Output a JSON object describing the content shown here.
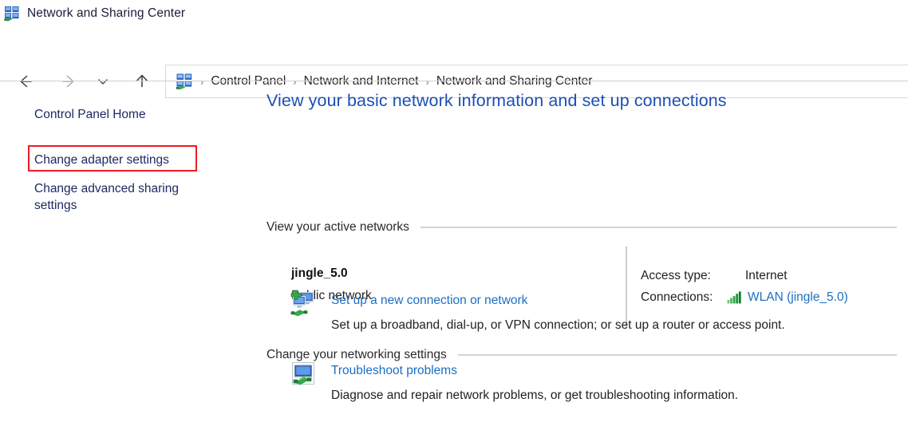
{
  "window": {
    "title": "Network and Sharing Center",
    "icon": "network-sharing-icon"
  },
  "nav": {
    "back_icon": "arrow-left-icon",
    "forward_icon": "arrow-right-icon",
    "recent_icon": "chevron-down-icon",
    "up_icon": "arrow-up-icon",
    "address_icon": "control-panel-network-icon",
    "breadcrumb": [
      "Control Panel",
      "Network and Internet",
      "Network and Sharing Center"
    ],
    "separator": "›"
  },
  "sidebar": {
    "items": [
      {
        "label": "Control Panel Home",
        "highlighted": false
      },
      {
        "label": "Change adapter settings",
        "highlighted": true
      },
      {
        "label": "Change advanced sharing settings",
        "highlighted": false
      }
    ],
    "highlight_color": "#ee1b24"
  },
  "main": {
    "page_title": "View your basic network information and set up connections",
    "sections": {
      "active_networks": "View your active networks",
      "networking_settings": "Change your networking settings"
    },
    "active_network": {
      "name": "jingle_5.0",
      "type": "Public network",
      "access_type_label": "Access type:",
      "access_type_value": "Internet",
      "connections_label": "Connections:",
      "connections_value": "WLAN (jingle_5.0)",
      "signal_icon": "wifi-signal-icon",
      "signal_color": "#2e9b3f"
    },
    "tasks": [
      {
        "icon": "setup-new-connection-icon",
        "link": "Set up a new connection or network",
        "description": "Set up a broadband, dial-up, or VPN connection; or set up a router or access point."
      },
      {
        "icon": "troubleshoot-icon",
        "link": "Troubleshoot problems",
        "description": "Diagnose and repair network problems, or get troubleshooting information."
      }
    ]
  },
  "colors": {
    "link": "#1c6fc4",
    "title": "#1c4fb5",
    "sidebar_text": "#1b2a63",
    "rule": "#d4d4d4"
  }
}
